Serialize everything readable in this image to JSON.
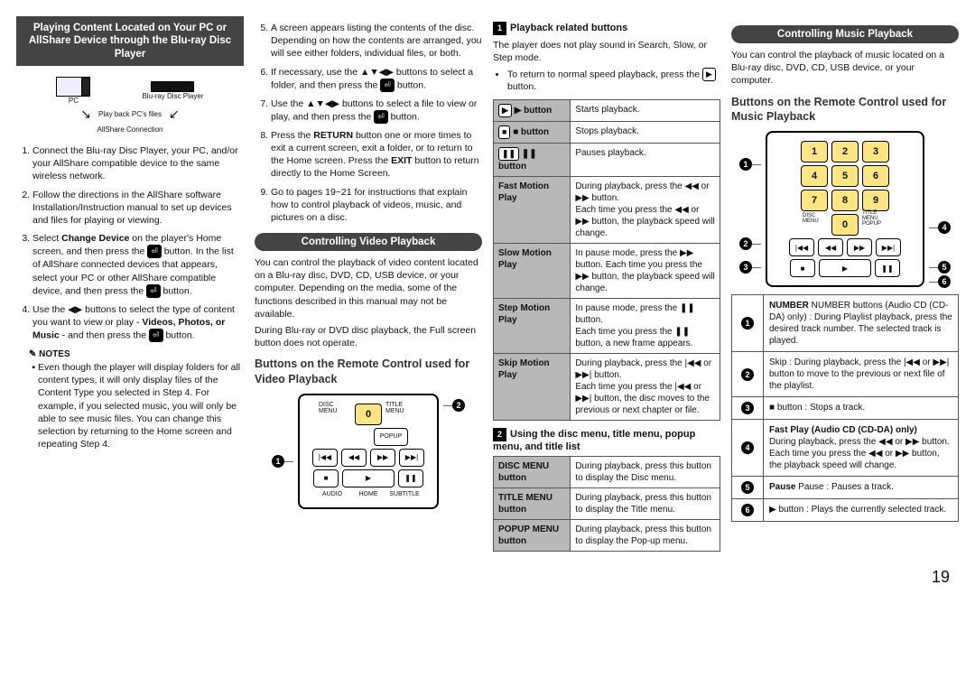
{
  "page_number": "19",
  "col1": {
    "header": "Playing Content Located on Your PC or AllShare Device through the Blu-ray Disc Player",
    "diagram": {
      "pc": "PC",
      "bdp": "Blu-ray Disc Player",
      "note": "Play back PC's files",
      "conn": "AllShare Connection"
    },
    "steps": {
      "s1": "Connect the Blu-ray Disc Player, your PC, and/or your AllShare compatible device to the same wireless network.",
      "s2": "Follow the directions in the AllShare software Installation/Instruction manual to set up devices and files for playing or viewing.",
      "s3a": "Select ",
      "s3b": " on the player's Home screen, and then press the ",
      "s3c": " button. In the list of AllShare connected devices that appears, select your PC or other AllShare compatible device, and then press the ",
      "s3d": " button.",
      "s3_bold": "Change Device",
      "s4a": "Use the ◀▶ buttons to select the type of content you want to view or play - ",
      "s4b": " - and then press the ",
      "s4c": " button.",
      "s4_bold": "Videos, Photos, or Music"
    },
    "notes_head": "NOTES",
    "notes": {
      "n1": "Even though the player will display folders for all content types, it will only display files of the Content Type you selected in Step 4. For example, if you selected music, you will only be able to see music files. You can change this selection by returning to the Home screen and repeating Step 4."
    }
  },
  "col2": {
    "steps": {
      "s5": "A screen appears listing the contents of the disc. Depending on how the contents are arranged, you will see either folders, individual files, or both.",
      "s6a": "If necessary, use the ▲▼◀▶ buttons to select a folder, and then press the ",
      "s6b": " button.",
      "s7a": "Use the ▲▼◀▶ buttons to select a file to view or play, and then press the ",
      "s7b": " button.",
      "s8a": "Press the ",
      "s8b": " button one or more times to exit a current screen, exit a folder, or to return to the Home screen. Press the ",
      "s8c": " button to return directly to the Home Screen.",
      "s8_bold1": "RETURN",
      "s8_bold2": "EXIT",
      "s9": "Go to pages 19~21 for instructions that explain how to control playback of videos, music, and pictures on a disc."
    },
    "cvp_header": "Controlling Video Playback",
    "cvp_p1": "You can control the playback of video content located on a Blu-ray disc, DVD, CD, USB device, or your computer. Depending on the media, some of the functions described in this manual may not be available.",
    "cvp_p2": "During Blu-ray or DVD disc playback, the Full screen button does not operate.",
    "brc_title": "Buttons on the Remote Control used for Video Playback",
    "remote_labels": {
      "disc": "DISC MENU",
      "title": "TITLE MENU",
      "zero": "0",
      "popup": "POPUP",
      "audio": "AUDIO",
      "home": "HOME",
      "sub": "SUBTITLE"
    }
  },
  "col3": {
    "h1_title": "Playback related buttons",
    "h1_p1": "The player does not play sound in Search, Slow, or Step mode.",
    "h1_b1a": "To return to normal speed playback, press the ",
    "h1_b1b": " button.",
    "tbl1": {
      "r1l": "▶ button",
      "r1d": "Starts playback.",
      "r2l": "■ button",
      "r2d": "Stops playback.",
      "r3l": "❚❚ button",
      "r3d": "Pauses playback.",
      "r4l": "Fast Motion Play",
      "r4d": "During playback, press the ◀◀ or ▶▶ button.\nEach time you press the ◀◀ or ▶▶ button, the playback speed will change.",
      "r5l": "Slow Motion Play",
      "r5d": "In pause mode, press the ▶▶ button. Each time you press the ▶▶ button, the playback speed will change.",
      "r6l": "Step Motion Play",
      "r6d": "In pause mode, press the ❚❚ button.\nEach time you press the ❚❚ button, a new frame appears.",
      "r7l": "Skip Motion Play",
      "r7d": "During playback, press the |◀◀ or ▶▶| button.\nEach time you press the |◀◀ or ▶▶| button, the disc moves to the previous or next chapter or file."
    },
    "h2_title": "Using the disc menu, title menu, popup menu, and title list",
    "tbl2": {
      "r1l": "DISC MENU button",
      "r1d": "During playback, press this button to display the Disc menu.",
      "r2l": "TITLE MENU button",
      "r2d": "During playback, press this button to display the Title menu.",
      "r3l": "POPUP MENU button",
      "r3d": "During playback, press this button to display the Pop-up menu."
    }
  },
  "col4": {
    "header": "Controlling Music Playback",
    "p1": "You can control the playback of music located on a Blu-ray disc, DVD, CD, USB device, or your computer.",
    "brc_title": "Buttons on the Remote Control used for Music Playback",
    "tbl": {
      "r1": "NUMBER buttons (Audio CD (CD-DA) only) : During Playlist playback, press the desired track number. The selected track is played.",
      "r2": "Skip : During playback, press the |◀◀ or ▶▶| button to move to the previous or next file of the playlist.",
      "r3": "■ button : Stops a track.",
      "r4h": "Fast Play (Audio CD (CD-DA) only)",
      "r4": "During playback, press the ◀◀ or ▶▶ button.\nEach time you press the ◀◀ or ▶▶ button, the playback speed will change.",
      "r5": "Pause : Pauses a track.",
      "r6": "▶ button : Plays the currently selected track."
    }
  }
}
